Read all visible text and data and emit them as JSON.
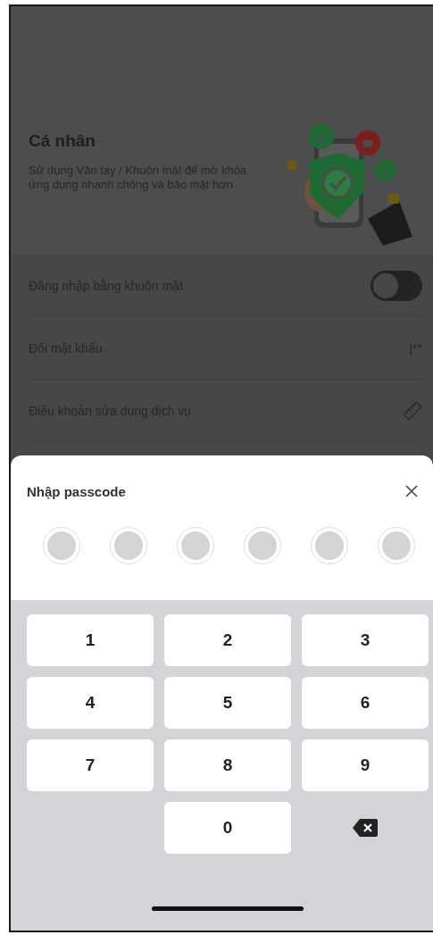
{
  "header": {
    "title": "Cá nhân",
    "description": "Sử dụng Vân tay / Khuôn mặt để mở khóa ứng dụng nhanh chóng và bảo mật hơn"
  },
  "settings": [
    {
      "kind": "toggle",
      "label": "Đăng nhập bằng khuôn mặt",
      "on": false
    },
    {
      "kind": "text",
      "label": "Đổi mật khẩu",
      "value": "|**"
    },
    {
      "kind": "icon",
      "label": "Điều khoản sửa dụng dịch vụ"
    }
  ],
  "passcode_sheet": {
    "title": "Nhập passcode",
    "dots": [
      {
        "filled": false
      },
      {
        "filled": false
      },
      {
        "filled": false
      },
      {
        "filled": false
      },
      {
        "filled": false
      },
      {
        "filled": false
      }
    ],
    "keys": [
      {
        "kind": "digit",
        "label": "1"
      },
      {
        "kind": "digit",
        "label": "2"
      },
      {
        "kind": "digit",
        "label": "3"
      },
      {
        "kind": "digit",
        "label": "4"
      },
      {
        "kind": "digit",
        "label": "5"
      },
      {
        "kind": "digit",
        "label": "6"
      },
      {
        "kind": "digit",
        "label": "7"
      },
      {
        "kind": "digit",
        "label": "8"
      },
      {
        "kind": "digit",
        "label": "9"
      },
      {
        "kind": "blank"
      },
      {
        "kind": "digit",
        "label": "0"
      },
      {
        "kind": "delete"
      }
    ]
  }
}
